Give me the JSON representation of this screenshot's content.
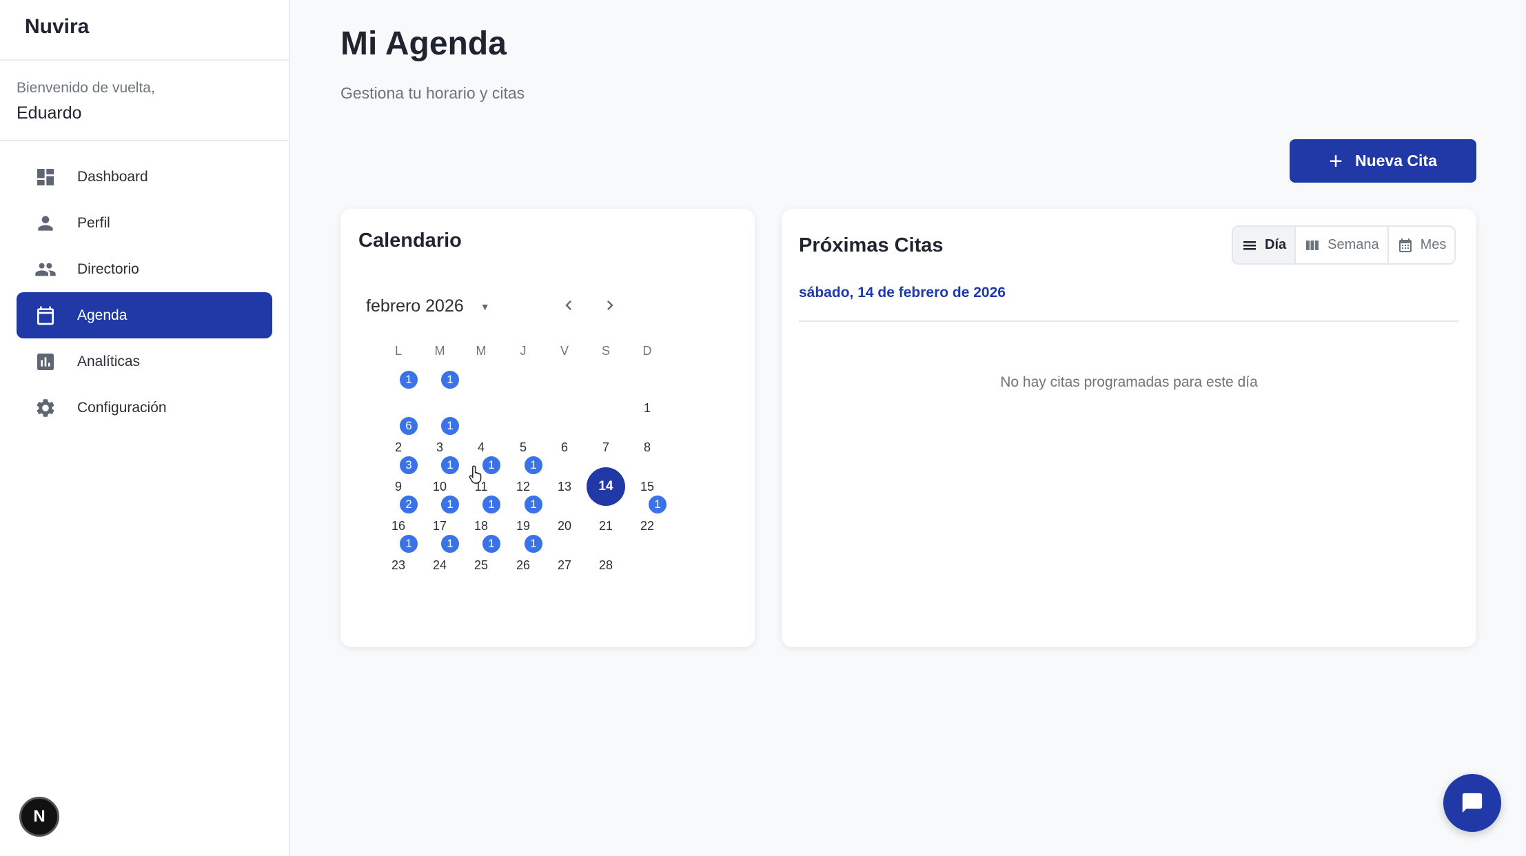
{
  "app": {
    "brand": "Nuvira",
    "avatar_initial": "N"
  },
  "user": {
    "welcome_label": "Bienvenido de vuelta,",
    "name": "Eduardo"
  },
  "sidebar": {
    "items": [
      {
        "label": "Dashboard",
        "icon": "dashboard-icon",
        "active": false
      },
      {
        "label": "Perfil",
        "icon": "person-icon",
        "active": false
      },
      {
        "label": "Directorio",
        "icon": "people-icon",
        "active": false
      },
      {
        "label": "Agenda",
        "icon": "calendar-icon",
        "active": true
      },
      {
        "label": "Analíticas",
        "icon": "bar-chart-icon",
        "active": false
      },
      {
        "label": "Configuración",
        "icon": "gear-icon",
        "active": false
      }
    ]
  },
  "header": {
    "title": "Mi Agenda",
    "subtitle": "Gestiona tu horario y citas"
  },
  "actions": {
    "new_appointment": "Nueva Cita"
  },
  "calendar": {
    "title": "Calendario",
    "month_label": "febrero 2026",
    "weekdays": [
      "L",
      "M",
      "M",
      "J",
      "V",
      "S",
      "D"
    ],
    "selected_day": "14",
    "weeks": [
      [
        "",
        "",
        "",
        "",
        "",
        "",
        "1"
      ],
      [
        "2",
        "3",
        "4",
        "5",
        "6",
        "7",
        "8"
      ],
      [
        "9",
        "10",
        "11",
        "12",
        "13",
        "14",
        "15"
      ],
      [
        "16",
        "17",
        "18",
        "19",
        "20",
        "21",
        "22"
      ],
      [
        "23",
        "24",
        "25",
        "26",
        "27",
        "28",
        ""
      ]
    ],
    "top_badges": [
      "1",
      "1"
    ],
    "badges": [
      {
        "day": "2",
        "count": "6"
      },
      {
        "day": "3",
        "count": "1"
      },
      {
        "day": "9",
        "count": "3"
      },
      {
        "day": "10",
        "count": "1"
      },
      {
        "day": "11",
        "count": "1"
      },
      {
        "day": "12",
        "count": "1"
      },
      {
        "day": "16",
        "count": "2"
      },
      {
        "day": "17",
        "count": "1"
      },
      {
        "day": "18",
        "count": "1"
      },
      {
        "day": "19",
        "count": "1"
      },
      {
        "day": "22",
        "count": "1"
      },
      {
        "day": "23",
        "count": "1"
      },
      {
        "day": "24",
        "count": "1"
      },
      {
        "day": "25",
        "count": "1"
      },
      {
        "day": "26",
        "count": "1"
      }
    ]
  },
  "appointments": {
    "title": "Próximas Citas",
    "views": [
      {
        "label": "Día",
        "icon": "list-icon",
        "active": true
      },
      {
        "label": "Semana",
        "icon": "week-columns-icon",
        "active": false
      },
      {
        "label": "Mes",
        "icon": "calendar-month-icon",
        "active": false
      }
    ],
    "selected_date": "sábado, 14 de febrero de 2026",
    "empty_message": "No hay citas programadas para este día"
  },
  "colors": {
    "primary": "#2139a7",
    "badge": "#3a73e8",
    "background": "#f8f9fa"
  }
}
